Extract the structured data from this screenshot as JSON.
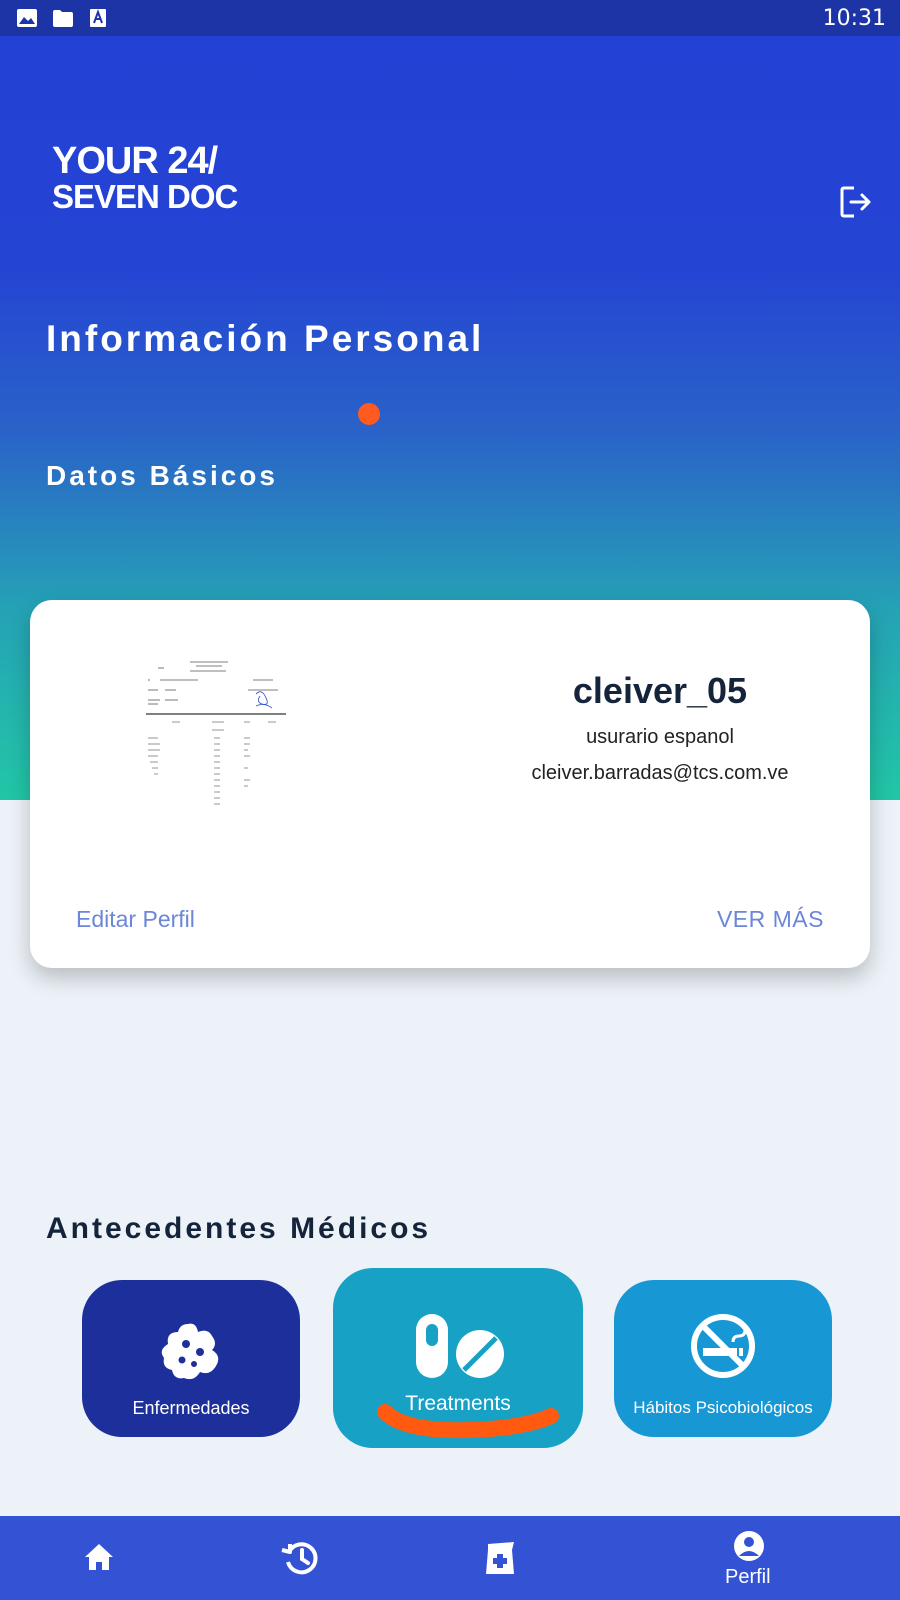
{
  "status_bar": {
    "time": "10:31",
    "icons": [
      "image-icon",
      "folder-icon",
      "font-icon"
    ]
  },
  "header": {
    "logo_line1": "YOUR 24/",
    "logo_line2": "SEVEN DOC",
    "logout_icon": "logout-icon"
  },
  "page": {
    "title": "Información Personal",
    "section_basic": "Datos Básicos"
  },
  "profile": {
    "username": "cleiver_05",
    "subtitle": "usurario espanol",
    "email": "cleiver.barradas@tcs.com.ve",
    "edit_label": "Editar Perfil",
    "more_label": "VER MÁS"
  },
  "medical": {
    "title": "Antecedentes Médicos",
    "tiles": [
      {
        "label": "Enfermedades",
        "icon": "virus-icon"
      },
      {
        "label": "Treatments",
        "icon": "pills-icon"
      },
      {
        "label": "Hábitos Psicobiológicos",
        "icon": "no-smoking-icon"
      }
    ]
  },
  "nav": {
    "items": [
      {
        "icon": "home-icon",
        "label": ""
      },
      {
        "icon": "history-icon",
        "label": ""
      },
      {
        "icon": "medical-kit-icon",
        "label": ""
      },
      {
        "icon": "profile-icon",
        "label": "Perfil"
      }
    ]
  },
  "colors": {
    "accent_dot": "#ff5a1f",
    "nav_bg": "#3452d4",
    "link": "#6c86d8"
  }
}
